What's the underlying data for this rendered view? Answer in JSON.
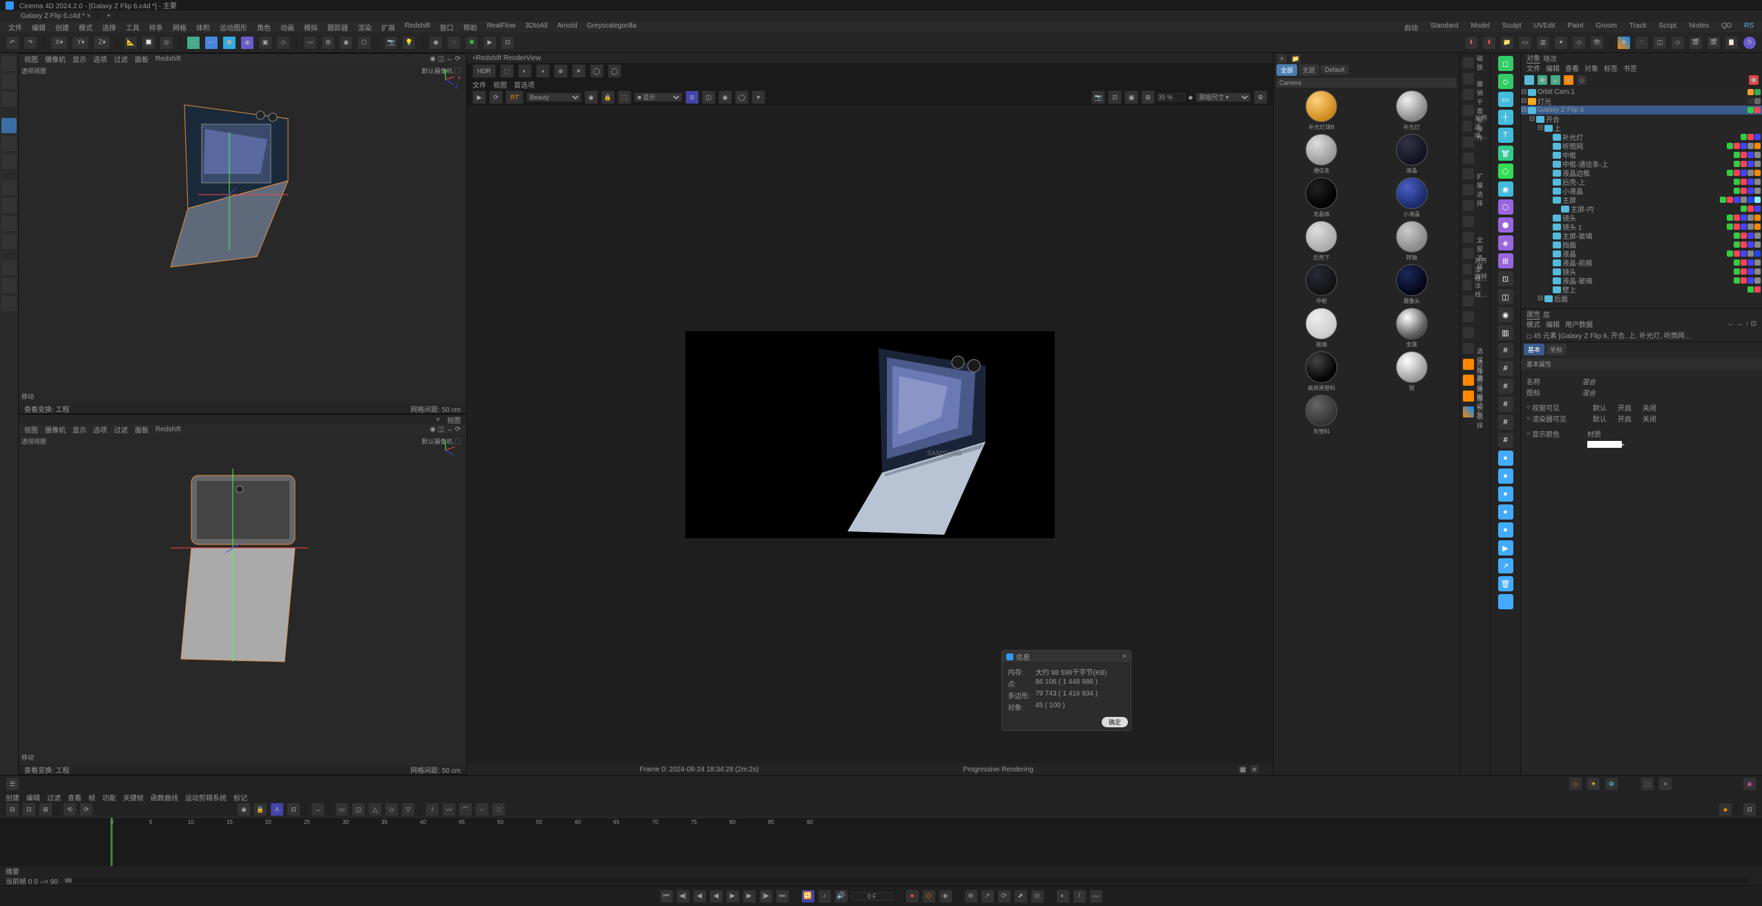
{
  "window_title": "Cinema 4D 2024.2.0 - [Galaxy Z Flip 6.c4d *] - 主要",
  "file_tabs": [
    "Galaxy Z Flip 6.c4d *"
  ],
  "main_menu": {
    "left": [
      "文件",
      "编辑",
      "创建",
      "模式",
      "选择",
      "工具",
      "样条",
      "网格",
      "体积",
      "运动图形",
      "角色",
      "动画",
      "模拟",
      "跟踪器",
      "渲染",
      "扩展",
      "Redshift",
      "窗口",
      "帮助",
      "RealFlow",
      "3DtoAll",
      "Arnold",
      "Greyscalegorilla"
    ],
    "right": [
      "启动",
      "Standard",
      "Model",
      "Sculpt",
      "UVEdit",
      "Paint",
      "Groom",
      "Track",
      "Script",
      "Nodes",
      "QD",
      "RS"
    ]
  },
  "toolbar_xyz": [
    "X",
    "Y",
    "Z"
  ],
  "viewport": {
    "menu1": [
      "视图",
      "摄像机",
      "显示",
      "选项",
      "过滤",
      "面板",
      "Redshift"
    ],
    "caption_left": "查看变换: 工程",
    "caption_right": "网格间距: 50 cm",
    "label": "透视视图",
    "camera": "默认摄像机 ▢",
    "move": "移动",
    "tab2": "视图"
  },
  "renderview": {
    "title": "Redshift RenderView",
    "menu": [
      "文件",
      "视图",
      "首选项"
    ],
    "rt": "RT",
    "mode": "Beauty",
    "hdr": "HDR",
    "sel_mode": [
      "■",
      "显示",
      "▾"
    ],
    "scale_val": "35 %",
    "scale_label": "原始尺寸 ▾",
    "status_left": "Frame   0:  2024-08-24  18:34:28  (2m:2s)",
    "status_right": "Progressive Rendering"
  },
  "materials": {
    "tabs": [
      "全部",
      "无层",
      "Default"
    ],
    "header": "Camera",
    "items": [
      {
        "label": "补光灯球B",
        "bg": "radial-gradient(circle at 35% 30%,#ffd27a,#cc8a1a 70%)"
      },
      {
        "label": "补光灯",
        "bg": "radial-gradient(circle at 35% 30%,#eee,#888 70%)"
      },
      {
        "label": "通信条",
        "bg": "radial-gradient(circle at 35% 30%,#ddd,#999 70%)"
      },
      {
        "label": "液晶",
        "bg": "radial-gradient(circle at 35% 30%,#334,#112 70%)"
      },
      {
        "label": "龙晶体",
        "bg": "radial-gradient(circle at 35% 30%,#222,#000 70%)"
      },
      {
        "label": "小液晶",
        "bg": "radial-gradient(circle at 35% 30%,#4a5fc4,#1a2a6a 70%)"
      },
      {
        "label": "后壳下",
        "bg": "radial-gradient(circle at 35% 30%,#ddd,#aaa 70%)"
      },
      {
        "label": "转轴",
        "bg": "radial-gradient(circle at 35% 30%,#ccc,#888 70%)"
      },
      {
        "label": "中框",
        "bg": "radial-gradient(circle at 35% 30%,#2a2a3a,#111 70%)"
      },
      {
        "label": "摄像头",
        "bg": "radial-gradient(circle at 35% 30%,#1a2a5a,#050515 70%)"
      },
      {
        "label": "玻璃",
        "bg": "radial-gradient(circle at 35% 30%,#eee,#ccc 70%,#888)"
      },
      {
        "label": "金属",
        "bg": "radial-gradient(circle at 35% 30%,#fff,#666 60%,#222)"
      },
      {
        "label": "高亮黑塑料",
        "bg": "radial-gradient(circle at 35% 30%,#444,#000 70%)"
      },
      {
        "label": "银",
        "bg": "radial-gradient(circle at 35% 30%,#fff,#999 70%)"
      },
      {
        "label": "灰塑料",
        "bg": "radial-gradient(circle at 35% 30%,#666,#333 70%)"
      }
    ]
  },
  "commands": [
    {
      "label": "磁铁"
    },
    {
      "label": ""
    },
    {
      "label": ""
    },
    {
      "label": "撤销干面板操作"
    },
    {
      "label": "对称选择…"
    },
    {
      "label": ""
    },
    {
      "label": ""
    },
    {
      "label": ""
    },
    {
      "label": "扩展选择"
    },
    {
      "label": ""
    },
    {
      "label": ""
    },
    {
      "label": ""
    },
    {
      "label": "全部选择"
    },
    {
      "label": "对齐法线…"
    },
    {
      "label": "旋转法线…"
    },
    {
      "label": ""
    },
    {
      "label": ""
    },
    {
      "label": ""
    },
    {
      "label": ""
    },
    {
      "label": "选择轮廓"
    },
    {
      "label": "选择三角形"
    },
    {
      "label": "选择四边形"
    },
    {
      "label": "增长选择"
    }
  ],
  "right_tabs": [
    "对象",
    "场次"
  ],
  "right_menu": [
    "文件",
    "编辑",
    "查看",
    "对象",
    "标签",
    "书签"
  ],
  "objects": [
    {
      "d": 0,
      "i": "#5bd",
      "n": "Orbit Cam.1",
      "t": [
        "#f93",
        "#3a5"
      ]
    },
    {
      "d": 0,
      "i": "#fa2",
      "n": "灯光",
      "t": [
        "#333",
        "#666"
      ]
    },
    {
      "d": 0,
      "i": "#5bd",
      "n": "Galaxy Z Flip  6",
      "sel": true,
      "t": [
        "#3c4",
        "#f45"
      ]
    },
    {
      "d": 1,
      "i": "#5bd",
      "n": "开合",
      "t": []
    },
    {
      "d": 2,
      "i": "#5bd",
      "n": "上",
      "t": []
    },
    {
      "d": 3,
      "i": "#5bd",
      "n": "补光灯",
      "t": [
        "#3c4",
        "#f45",
        "#44f"
      ]
    },
    {
      "d": 3,
      "i": "#5bd",
      "n": "听筒网",
      "t": [
        "#3c4",
        "#f45",
        "#44f",
        "#888",
        "#f80"
      ]
    },
    {
      "d": 3,
      "i": "#5bd",
      "n": "中框",
      "t": [
        "#3c4",
        "#f45",
        "#44f",
        "#888"
      ]
    },
    {
      "d": 3,
      "i": "#5bd",
      "n": "中框-通信条-上",
      "t": [
        "#3c4",
        "#f45",
        "#44f",
        "#888"
      ]
    },
    {
      "d": 3,
      "i": "#5bd",
      "n": "液晶边框",
      "t": [
        "#3c4",
        "#f45",
        "#44f",
        "#888",
        "#f80"
      ]
    },
    {
      "d": 3,
      "i": "#5bd",
      "n": "后壳-上",
      "t": [
        "#3c4",
        "#f45",
        "#44f",
        "#888"
      ]
    },
    {
      "d": 3,
      "i": "#5bd",
      "n": "小液晶",
      "t": [
        "#3c4",
        "#f45",
        "#44f",
        "#888"
      ]
    },
    {
      "d": 3,
      "i": "#5bd",
      "n": "主屏",
      "t": [
        "#3c4",
        "#f45",
        "#44f",
        "#888",
        "#24f",
        "#8ef"
      ]
    },
    {
      "d": 4,
      "i": "#5bd",
      "n": "主屏-内",
      "t": [
        "#3c4",
        "#f45",
        "#44f"
      ]
    },
    {
      "d": 3,
      "i": "#5bd",
      "n": "镜头",
      "t": [
        "#3c4",
        "#f45",
        "#44f",
        "#888",
        "#f80"
      ]
    },
    {
      "d": 3,
      "i": "#5bd",
      "n": "镜头 1",
      "t": [
        "#3c4",
        "#f45",
        "#44f",
        "#888",
        "#f80"
      ]
    },
    {
      "d": 3,
      "i": "#5bd",
      "n": "主屏-玻璃",
      "t": [
        "#3c4",
        "#f45",
        "#44f",
        "#888"
      ]
    },
    {
      "d": 3,
      "i": "#5bd",
      "n": "挡面",
      "t": [
        "#3c4",
        "#f45",
        "#44f",
        "#888"
      ]
    },
    {
      "d": 3,
      "i": "#5bd",
      "n": "液晶",
      "t": [
        "#3c4",
        "#f45",
        "#44f",
        "#888",
        "#24f"
      ]
    },
    {
      "d": 3,
      "i": "#5bd",
      "n": "液晶-前膜",
      "t": [
        "#3c4",
        "#f45",
        "#44f",
        "#888"
      ]
    },
    {
      "d": 3,
      "i": "#5bd",
      "n": "镜头",
      "t": [
        "#3c4",
        "#f45",
        "#44f",
        "#888"
      ]
    },
    {
      "d": 3,
      "i": "#5bd",
      "n": "液晶-玻璃",
      "t": [
        "#3c4",
        "#f45",
        "#44f",
        "#888"
      ]
    },
    {
      "d": 3,
      "i": "#5bd",
      "n": "壁上",
      "t": [
        "#3c4",
        "#f45"
      ]
    },
    {
      "d": 2,
      "i": "#5bd",
      "n": "后面",
      "t": []
    }
  ],
  "attributes": {
    "menu": [
      "模式",
      "编辑",
      "用户数据"
    ],
    "breadcrumb": "45 元素 [Galaxy Z Flip  6, 开合, 上, 补光灯, 听筒网...",
    "tabs": [
      "基本",
      "坐标"
    ],
    "section": "基本属性",
    "name_label": "名称",
    "name_value": "混合",
    "layer_label": "图标",
    "layer_value": "混合",
    "vis_label": "视窗可见",
    "render_vis_label": "渲染器可见",
    "options": [
      "默认",
      "开启",
      "关闭"
    ],
    "color_label": "显示颜色",
    "color_value": "材质"
  },
  "timeline": {
    "menu": [
      "创建",
      "编辑",
      "过滤",
      "查看",
      "帧",
      "功能",
      "关键帧",
      "函数曲线",
      "运动剪辑系统",
      "标记"
    ],
    "bottom_left": "摘要",
    "bottom_range": "当前帧 0    0 --> 90",
    "marks": [
      "0",
      "5",
      "10",
      "15",
      "20",
      "25",
      "30",
      "35",
      "40",
      "45",
      "50",
      "55",
      "60",
      "65",
      "70",
      "75",
      "80",
      "85",
      "90"
    ]
  },
  "playback": {
    "frame": "0 F"
  },
  "info_dialog": {
    "title": "信息",
    "rows": [
      [
        "内存:",
        "大约 98 598千字节(KB)"
      ],
      [
        "点:",
        "86 106 ( 1 448 986 )"
      ],
      [
        "多边形:",
        "79 743 ( 1 416 934 )"
      ],
      [
        "对象:",
        "45 ( 100 )"
      ]
    ],
    "ok": "确定"
  }
}
